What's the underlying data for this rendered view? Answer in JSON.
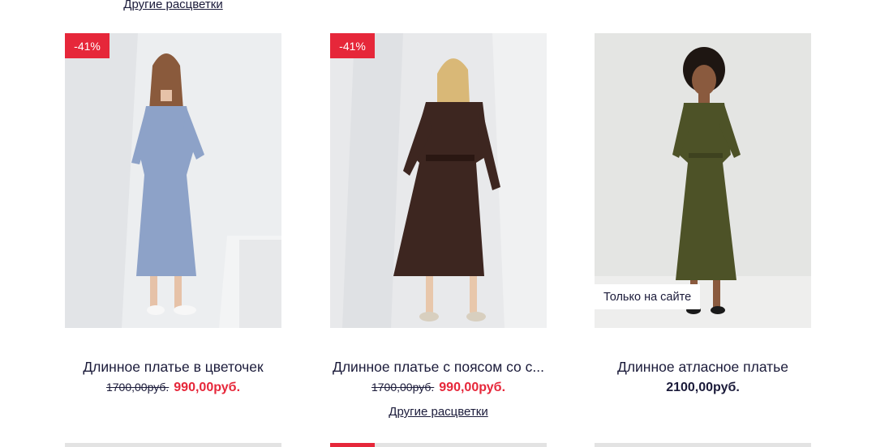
{
  "top_link": "Другие расцветки",
  "products": [
    {
      "badge": "-41%",
      "name": "Длинное платье в цветочек",
      "old_price": "1700,00руб.",
      "price": "990,00руб.",
      "dress_color": "#8da2c8",
      "image_icon": "model-floral-dress-photo"
    },
    {
      "badge": "-41%",
      "name": "Длинное платье с поясом со с...",
      "old_price": "1700,00руб.",
      "price": "990,00руб.",
      "colors_link": "Другие расцветки",
      "dress_color": "#3d2620",
      "image_icon": "model-brown-dress-photo"
    },
    {
      "tag": "Только на сайте",
      "name": "Длинное атласное платье",
      "price": "2100,00руб.",
      "dress_color": "#4d5227",
      "image_icon": "model-olive-dress-photo"
    }
  ],
  "colors": {
    "accent": "#e6273a",
    "text": "#1b1b3a"
  }
}
